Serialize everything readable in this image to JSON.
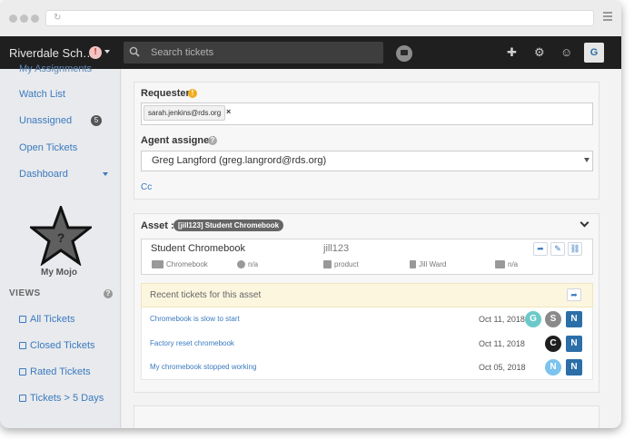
{
  "app": {
    "title": "Riverdale Sch…",
    "search_placeholder": "Search tickets",
    "user_initial": "G",
    "alert_glyph": "!"
  },
  "sidebar": {
    "items": [
      {
        "label": "My Assignments"
      },
      {
        "label": "Watch List"
      },
      {
        "label": "Unassigned",
        "count": "5"
      },
      {
        "label": "Open Tickets"
      },
      {
        "label": "Dashboard"
      }
    ],
    "mojo_label": "My Mojo",
    "views_heading": "VIEWS",
    "views_help": "?",
    "views": [
      {
        "label": "All Tickets"
      },
      {
        "label": "Closed Tickets"
      },
      {
        "label": "Rated Tickets"
      },
      {
        "label": "Tickets > 5 Days"
      }
    ]
  },
  "requester": {
    "label": "Requester",
    "warn_glyph": "!",
    "chip": "sarah.jenkins@rds.org",
    "chip_remove": "×"
  },
  "agent": {
    "label": "Agent assigned",
    "help_glyph": "?",
    "value": "Greg Langford (greg.langrord@rds.org)"
  },
  "cc": {
    "label": "Cc"
  },
  "asset": {
    "label": "Asset :",
    "badge": "[jill123] Student Chromebook",
    "name": "Student Chromebook",
    "tag": "jill123",
    "category": "Chromebook",
    "location": "n/a",
    "type": "product",
    "owner": "Jill Ward",
    "serial": "n/a",
    "actions": [
      "open-icon",
      "edit-icon",
      "unlink-icon"
    ]
  },
  "recent": {
    "title": "Recent tickets for this asset",
    "tickets": [
      {
        "title": "Chromebook is slow to start",
        "date": "Oct 11, 2018",
        "avatars": [
          {
            "letter": "G",
            "color": "#6cc9c9"
          },
          {
            "letter": "S",
            "color": "#8a8a8a"
          }
        ],
        "badge": "N"
      },
      {
        "title": "Factory reset chromebook",
        "date": "Oct 11, 2018",
        "avatars": [
          {
            "letter": "C",
            "color": "#1e1e1e"
          }
        ],
        "badge": "N"
      },
      {
        "title": "My chromebook stopped working",
        "date": "Oct 05, 2018",
        "avatars": [
          {
            "letter": "N",
            "color": "#7cc3ee"
          }
        ],
        "badge": "N"
      }
    ]
  }
}
